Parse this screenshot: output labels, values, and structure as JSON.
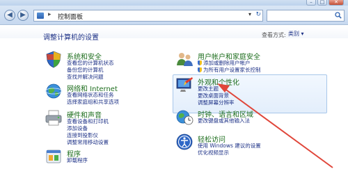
{
  "window": {
    "minimize": "–",
    "maximize": "□",
    "close": "✕"
  },
  "address": {
    "path": "控制面板",
    "separator": "▸",
    "dropdown": "▾",
    "refresh": "↻"
  },
  "header": {
    "title": "调整计算机的设置",
    "view_by_label": "查看方式:",
    "view_by_value": "类别 ▾"
  },
  "categories_left": [
    {
      "title": "系统和安全",
      "links": [
        {
          "text": "查看您的计算机状态",
          "shield": false
        },
        {
          "text": "备份您的计算机",
          "shield": false
        },
        {
          "text": "查找并解决问题",
          "shield": false
        }
      ]
    },
    {
      "title": "网络和 Internet",
      "links": [
        {
          "text": "查看网络状态和任务",
          "shield": false
        },
        {
          "text": "选择家庭组和共享选项",
          "shield": false
        }
      ]
    },
    {
      "title": "硬件和声音",
      "links": [
        {
          "text": "查看设备和打印机",
          "shield": false
        },
        {
          "text": "添加设备",
          "shield": false
        },
        {
          "text": "连接到投影仪",
          "shield": false
        },
        {
          "text": "调整常用移动设置",
          "shield": false
        }
      ]
    },
    {
      "title": "程序",
      "links": [
        {
          "text": "卸载程序",
          "shield": false
        }
      ]
    }
  ],
  "categories_right": [
    {
      "title": "用户帐户和家庭安全",
      "links": [
        {
          "text": "添加或删除用户帐户",
          "shield": true
        },
        {
          "text": "为所有用户设置家长控制",
          "shield": true
        }
      ]
    },
    {
      "title": "外观和个性化",
      "links": [
        {
          "text": "更改主题",
          "shield": false
        },
        {
          "text": "更改桌面背景",
          "shield": false
        },
        {
          "text": "调整屏幕分辨率",
          "shield": false
        }
      ]
    },
    {
      "title": "时钟、语言和区域",
      "links": [
        {
          "text": "更改键盘或其他输入法",
          "shield": false
        }
      ]
    },
    {
      "title": "轻松访问",
      "links": [
        {
          "text": "使用 Windows 建议的设置",
          "shield": false
        },
        {
          "text": "优化视频显示",
          "shield": false
        }
      ]
    }
  ],
  "colors": {
    "link": "#1e3287",
    "category_title": "#1e6e1e",
    "highlight_border": "#a8c7ea",
    "arrow": "#e0463a"
  }
}
